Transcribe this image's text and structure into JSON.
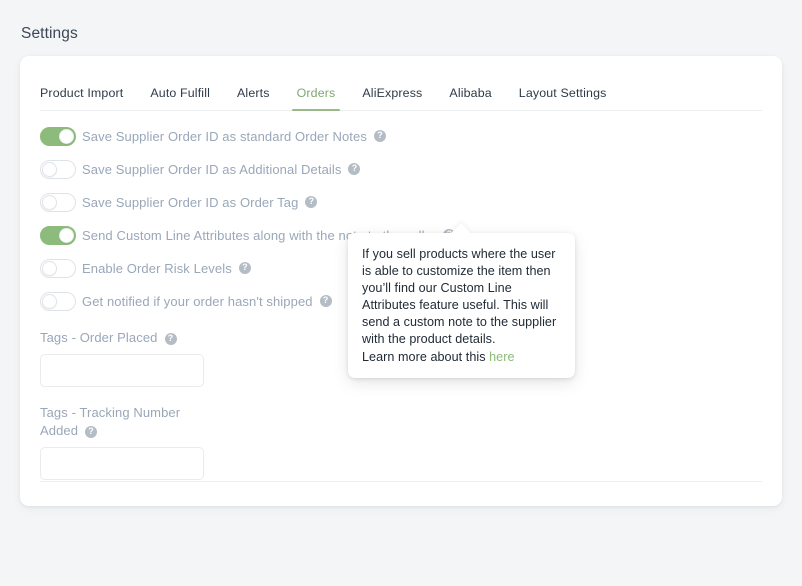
{
  "page": {
    "title": "Settings",
    "background_color": "#f4f5f6"
  },
  "theme": {
    "accent_green": "#8cbb7b",
    "label_gray": "#9aa7b9",
    "heading_dark": "#3c4858"
  },
  "tabs": [
    {
      "label": "Product Import",
      "active": false
    },
    {
      "label": "Auto Fulfill",
      "active": false
    },
    {
      "label": "Alerts",
      "active": false
    },
    {
      "label": "Orders",
      "active": true
    },
    {
      "label": "AliExpress",
      "active": false
    },
    {
      "label": "Alibaba",
      "active": false
    },
    {
      "label": "Layout Settings",
      "active": false
    }
  ],
  "toggles": [
    {
      "label": "Save Supplier Order ID as standard Order Notes",
      "on": true,
      "help_icon": "help-circle-icon",
      "help_glyph": "?"
    },
    {
      "label": "Save Supplier Order ID as Additional Details",
      "on": false,
      "help_icon": "help-circle-icon",
      "help_glyph": "?"
    },
    {
      "label": "Save Supplier Order ID as Order Tag",
      "on": false,
      "help_icon": "help-circle-icon",
      "help_glyph": "?"
    },
    {
      "label": "Send Custom Line Attributes along with the note to the seller",
      "on": true,
      "help_icon": "help-circle-icon",
      "help_glyph": "?"
    },
    {
      "label": "Enable Order Risk Levels",
      "on": false,
      "help_icon": "help-circle-icon",
      "help_glyph": "?"
    },
    {
      "label": "Get notified if your order hasn't shipped",
      "on": false,
      "help_icon": "help-circle-icon",
      "help_glyph": "?"
    }
  ],
  "fields": [
    {
      "label": "Tags - Order Placed",
      "value": "",
      "placeholder": "",
      "help_glyph": "?"
    },
    {
      "label": "Tags - Tracking Number Added",
      "value": "",
      "placeholder": "",
      "help_glyph": "?"
    }
  ],
  "tooltip": {
    "body": "If you sell products where the user is able to customize the item then you’ll find our Custom Line Attributes feature useful. This will send a custom note to the supplier with the product details.",
    "learn_prefix": "Learn more about this ",
    "link_label": "here",
    "link_color": "#8cbb7b"
  }
}
